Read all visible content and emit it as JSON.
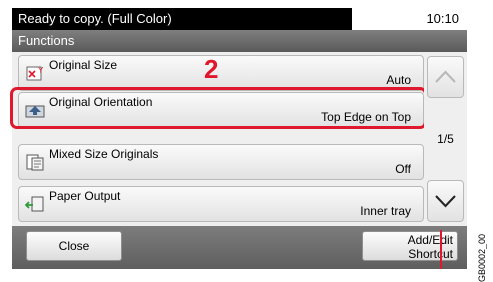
{
  "status": {
    "message": "Ready to copy. (Full Color)",
    "time": "10:10"
  },
  "header": {
    "title": "Functions"
  },
  "items": [
    {
      "label": "Original Size",
      "value": "Auto",
      "icon": "original-size-icon"
    },
    {
      "label": "Original Orientation",
      "value": "Top Edge on Top",
      "icon": "original-orientation-icon"
    },
    {
      "label": "Mixed Size Originals",
      "value": "Off",
      "icon": "mixed-size-originals-icon"
    },
    {
      "label": "Paper Output",
      "value": "Inner tray",
      "icon": "paper-output-icon"
    }
  ],
  "annotation": {
    "step": "2"
  },
  "scroll": {
    "page": "1/5"
  },
  "footer": {
    "close_label": "Close",
    "add_edit_line1": "Add/Edit",
    "add_edit_line2": "Shortcut"
  },
  "figure_id": "GB0002_00",
  "colors": {
    "highlight": "#e0182d",
    "status_bar": "#000000",
    "header_bar": "#6b6b6b"
  }
}
